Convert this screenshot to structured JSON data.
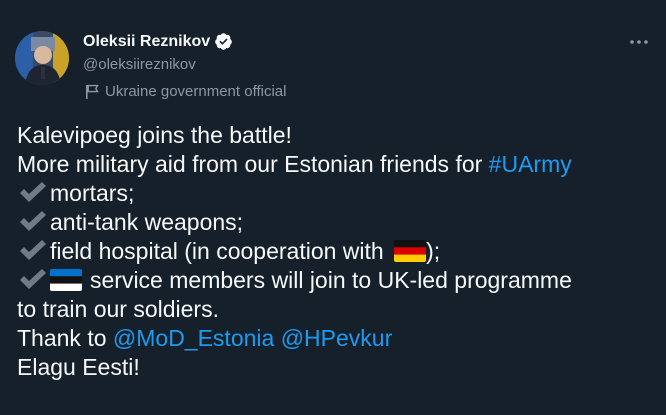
{
  "author": {
    "name": "Oleksii Reznikov",
    "handle": "@oleksiireznikov",
    "label": "Ukraine government official"
  },
  "icons": {
    "verified": "verified-badge-icon",
    "label": "flag-icon",
    "more": "more-icon",
    "check": "heavy-check-mark-icon",
    "germany": "germany-flag-icon",
    "estonia": "estonia-flag-icon"
  },
  "colors": {
    "background": "#15202b",
    "text": "#f7f9f9",
    "secondary": "#8b98a5",
    "link": "#1d9bf0"
  },
  "tweet": {
    "line1": "Kalevipoeg joins the battle!",
    "line2": "More military aid from our Estonian friends for ",
    "hashtag": "#UArmy",
    "item1": "mortars;",
    "item2": "anti-tank weapons;",
    "item3_prefix": "field hospital (in cooperation with ",
    "item3_suffix": ");",
    "item4": "service members will join to UK-led programme",
    "item4_cont": "to train our soldiers.",
    "thanks_prefix": "Thank to ",
    "mention1": "@MoD_Estonia",
    "mention2": "@HPevkur",
    "closing": "Elagu Eesti!"
  }
}
